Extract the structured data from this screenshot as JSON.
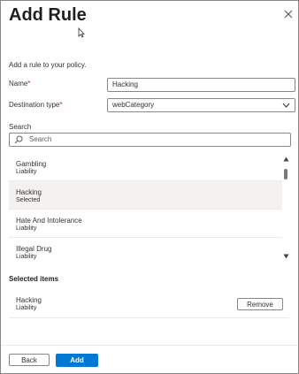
{
  "panel": {
    "title": "Add Rule",
    "close_icon": "close-icon"
  },
  "form": {
    "intro": "Add a rule to your policy.",
    "name_label": "Name",
    "name_required": "*",
    "name_value": "Hacking",
    "destination_label": "Destination type",
    "destination_required": "*",
    "destination_value": "webCategory",
    "search_label": "Search",
    "search_placeholder": "Search"
  },
  "list": {
    "items": [
      {
        "name": "Gambling",
        "status": "Liability",
        "selected": false
      },
      {
        "name": "Hacking",
        "status": "Selected",
        "selected": true
      },
      {
        "name": "Hate And Intolerance",
        "status": "Liability",
        "selected": false
      },
      {
        "name": "Illegal Drug",
        "status": "Liability",
        "selected": false
      }
    ]
  },
  "selected": {
    "title": "Selected items",
    "items": [
      {
        "name": "Hacking",
        "status": "Liability",
        "remove_label": "Remove"
      }
    ]
  },
  "footer": {
    "back_label": "Back",
    "add_label": "Add"
  },
  "colors": {
    "accent": "#0078d4",
    "required": "#a4262c",
    "selected_row": "#f3f2f1"
  }
}
